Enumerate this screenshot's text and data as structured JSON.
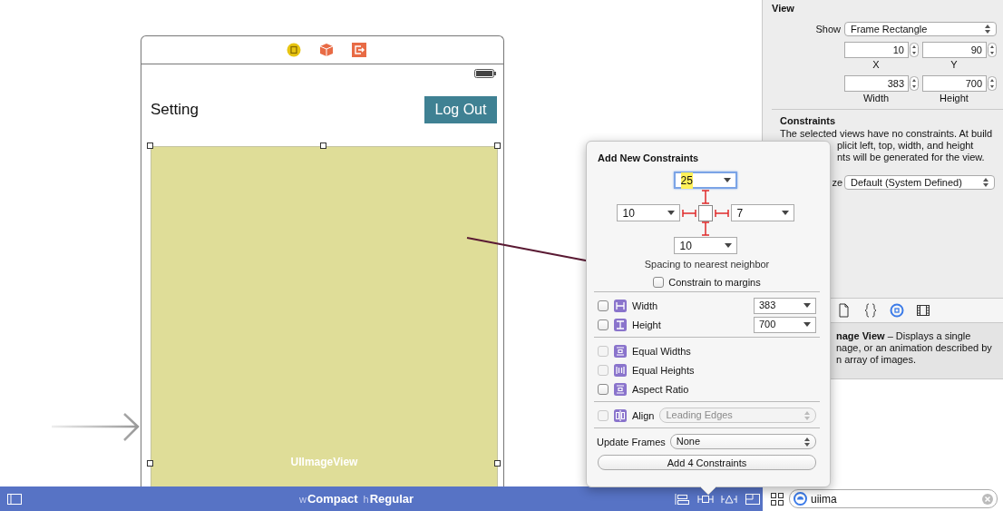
{
  "scene": {
    "title": "Setting",
    "button": "Log Out",
    "image_view_label": "UIImageView"
  },
  "size_class_bar": {
    "width_prefix": "w",
    "width_class": "Compact",
    "height_prefix": "h",
    "height_class": "Regular"
  },
  "inspector": {
    "section": "View",
    "show_label": "Show",
    "show_value": "Frame Rectangle",
    "fields": [
      {
        "label": "X",
        "value": "10"
      },
      {
        "label": "Y",
        "value": "90"
      },
      {
        "label": "Width",
        "value": "383"
      },
      {
        "label": "Height",
        "value": "700"
      }
    ],
    "constraints_title": "Constraints",
    "constraints_lines": [
      "The selected views have no constraints. At build",
      "plicit left, top, width, and height",
      "nts will be generated for the view."
    ],
    "intrinsic_label": "ze",
    "intrinsic_value": "Default (System Defined)"
  },
  "library": {
    "tabs": [
      {
        "selected": false
      },
      {
        "selected": false
      },
      {
        "selected": true
      },
      {
        "selected": false
      }
    ],
    "description_lines": [
      "**nage View** – Displays a single",
      "nage, or an animation described by",
      "n array of images."
    ],
    "search": {
      "value": "uiima"
    }
  },
  "popover": {
    "title": "Add New Constraints",
    "spacing": [
      {
        "value": "25",
        "focused": true
      },
      {
        "value": "10",
        "focused": false
      },
      {
        "value": "7",
        "focused": false
      },
      {
        "value": "10",
        "focused": false
      }
    ],
    "caption": "Spacing to nearest neighbor",
    "margins": {
      "label": "Constrain to margins",
      "checked": false
    },
    "groups": [
      [
        {
          "kind": "size",
          "label": "Width",
          "value": "383",
          "checked": false,
          "disabled": false
        },
        {
          "kind": "size",
          "label": "Height",
          "value": "700",
          "checked": false,
          "disabled": false
        }
      ],
      [
        {
          "kind": "plain",
          "label": "Equal Widths",
          "checked": false,
          "disabled": true
        },
        {
          "kind": "plain",
          "label": "Equal Heights",
          "checked": false,
          "disabled": true
        },
        {
          "kind": "plain",
          "label": "Aspect Ratio",
          "checked": false,
          "disabled": false
        }
      ]
    ],
    "align": {
      "label": "Align",
      "value": "Leading Edges",
      "checked": false,
      "disabled": true
    },
    "update_frames": {
      "label": "Update Frames",
      "value": "None"
    },
    "add_button": "Add 4 Constraints"
  }
}
